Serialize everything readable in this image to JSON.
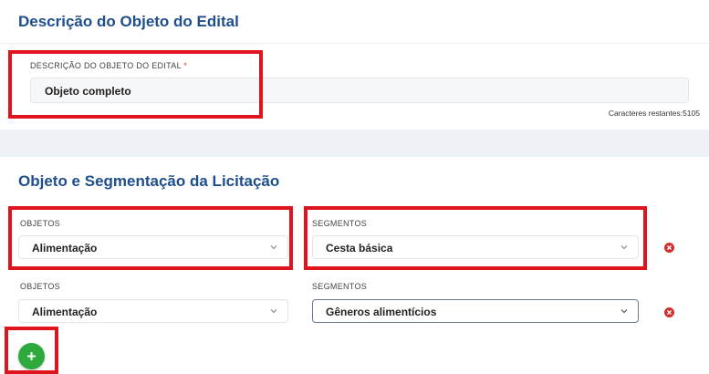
{
  "section_description": {
    "title": "Descrição do Objeto do Edital",
    "field_label": "DESCRIÇÃO DO OBJETO DO EDITAL",
    "required_mark": "*",
    "value": "Objeto completo",
    "remaining_chars": "Caracteres restantes:5105"
  },
  "section_segmentation": {
    "title": "Objeto e Segmentação da Licitação",
    "rows": [
      {
        "objects_label": "OBJETOS",
        "objects_value": "Alimentação",
        "segments_label": "SEGMENTOS",
        "segments_value": "Cesta básica"
      },
      {
        "objects_label": "OBJETOS",
        "objects_value": "Alimentação",
        "segments_label": "SEGMENTOS",
        "segments_value": "Gêneros alimentícios"
      }
    ]
  },
  "icons": {
    "chevron": "chevron-down-icon",
    "remove": "remove-circle-icon",
    "add": "plus-icon"
  },
  "colors": {
    "title": "#1f4e8c",
    "highlight": "#e0141c",
    "remove": "#d32f2f",
    "add": "#2eaa3c"
  }
}
